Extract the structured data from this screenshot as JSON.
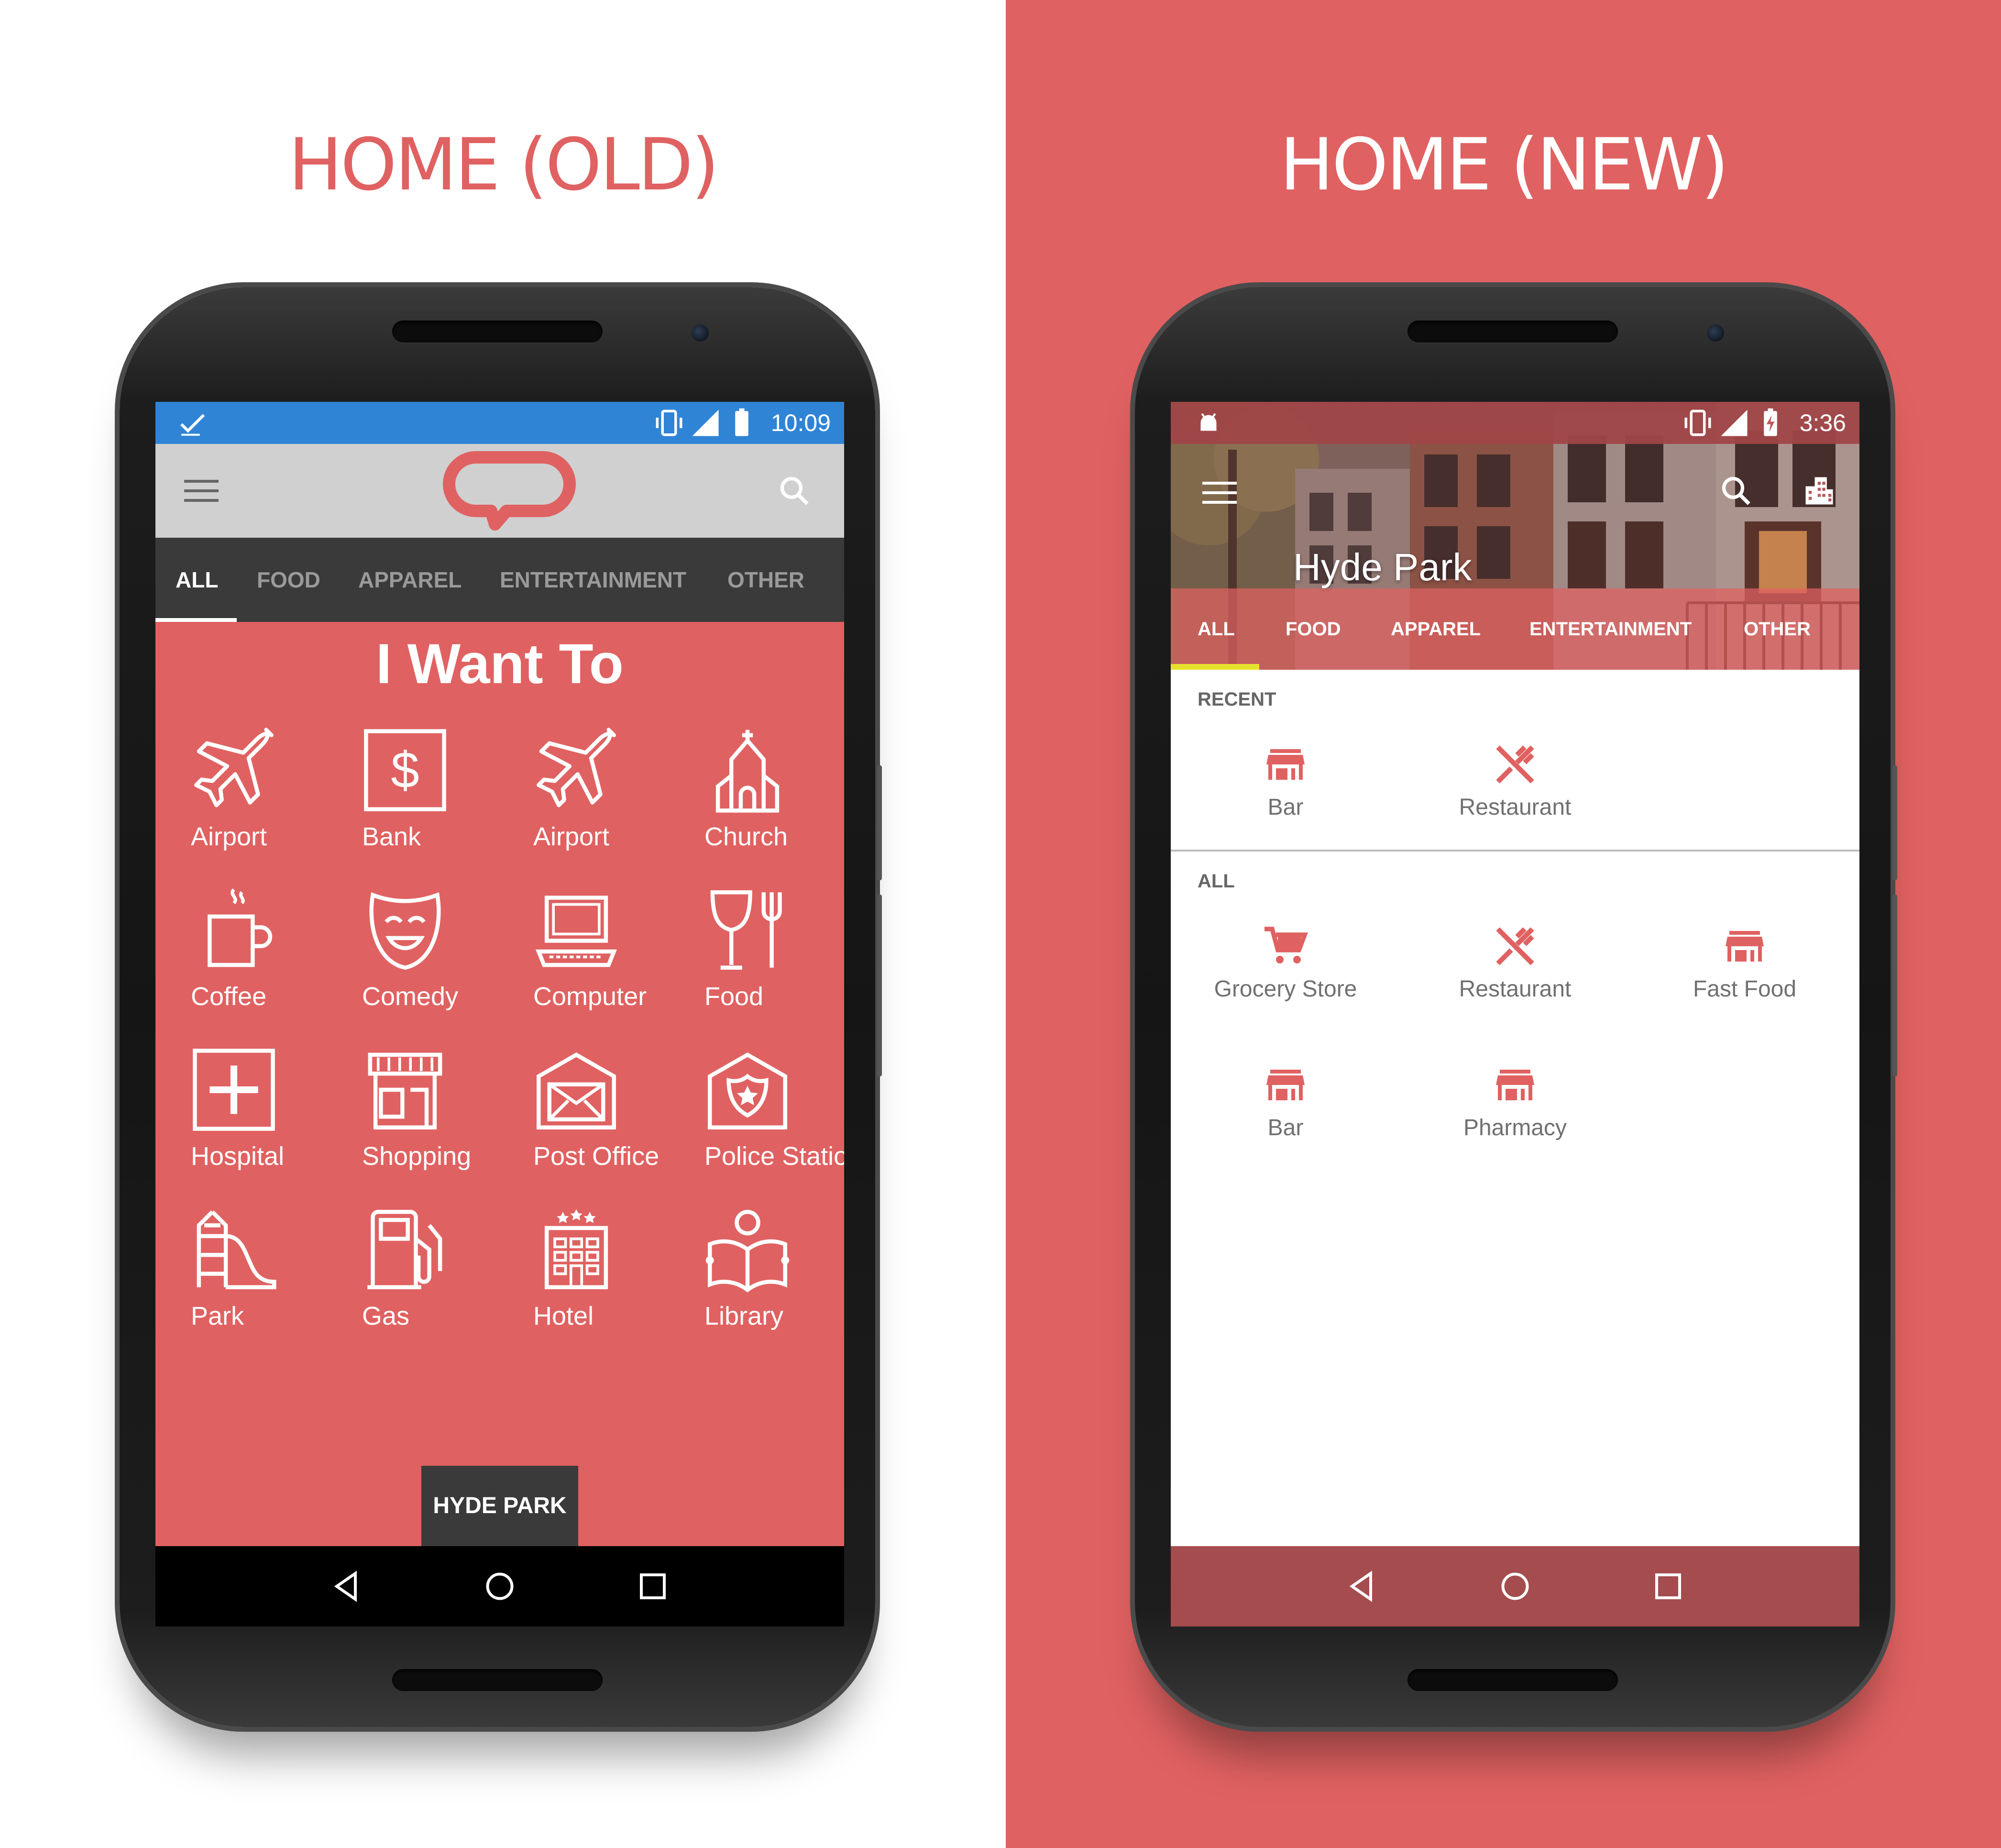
{
  "left_panel": {
    "title": "HOME (OLD)",
    "status_time": "10:09",
    "tabs": [
      "ALL",
      "FOOD",
      "APPAREL",
      "ENTERTAINMENT",
      "OTHER"
    ],
    "heading": "I Want To",
    "grid": [
      {
        "label": "Airport",
        "icon": "airplane-icon"
      },
      {
        "label": "Bank",
        "icon": "dollar-icon"
      },
      {
        "label": "Airport",
        "icon": "airplane-icon"
      },
      {
        "label": "Church",
        "icon": "church-icon"
      },
      {
        "label": "Coffee",
        "icon": "coffee-icon"
      },
      {
        "label": "Comedy",
        "icon": "comedy-mask-icon"
      },
      {
        "label": "Computer",
        "icon": "laptop-icon"
      },
      {
        "label": "Food",
        "icon": "glass-fork-icon"
      },
      {
        "label": "Hospital",
        "icon": "medical-cross-icon"
      },
      {
        "label": "Shopping",
        "icon": "storefront-icon"
      },
      {
        "label": "Post Office",
        "icon": "mail-icon"
      },
      {
        "label": "Police Station",
        "icon": "police-badge-icon"
      },
      {
        "label": "Park",
        "icon": "playground-slide-icon"
      },
      {
        "label": "Gas",
        "icon": "gas-pump-icon"
      },
      {
        "label": "Hotel",
        "icon": "hotel-icon"
      },
      {
        "label": "Library",
        "icon": "reading-book-icon"
      }
    ],
    "location_button": "HYDE PARK"
  },
  "right_panel": {
    "title": "HOME (NEW)",
    "status_time": "3:36",
    "place_name": "Hyde Park",
    "tabs": [
      "ALL",
      "FOOD",
      "APPAREL",
      "ENTERTAINMENT",
      "OTHER"
    ],
    "recent_label": "RECENT",
    "recent": [
      {
        "label": "Bar",
        "icon": "store-icon"
      },
      {
        "label": "Restaurant",
        "icon": "utensils-icon"
      }
    ],
    "all_label": "ALL",
    "all": [
      {
        "label": "Grocery Store",
        "icon": "cart-icon"
      },
      {
        "label": "Restaurant",
        "icon": "utensils-icon"
      },
      {
        "label": "Fast Food",
        "icon": "store-icon"
      },
      {
        "label": "Bar",
        "icon": "store-icon"
      },
      {
        "label": "Pharmacy",
        "icon": "store-icon"
      }
    ]
  },
  "colors": {
    "brand_red": "#e06161",
    "old_statusbar_blue": "#2f84d6",
    "tab_indicator_yellow": "#e6e22c",
    "new_navbar": "#a44c4e"
  }
}
